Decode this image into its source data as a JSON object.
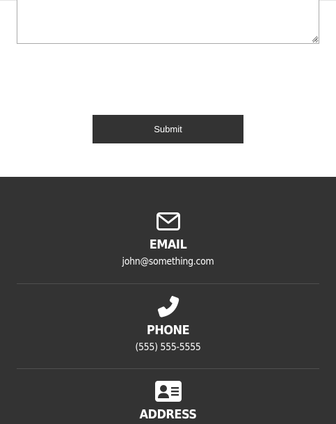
{
  "form": {
    "message_value": "",
    "submit_label": "Submit"
  },
  "footer": {
    "background": "#333333",
    "contacts": [
      {
        "icon": "envelope-icon",
        "title": "EMAIL",
        "value": "john@something.com"
      },
      {
        "icon": "phone-icon",
        "title": "PHONE",
        "value": "(555) 555-5555"
      },
      {
        "icon": "address-card-icon",
        "title": "ADDRESS"
      }
    ]
  }
}
